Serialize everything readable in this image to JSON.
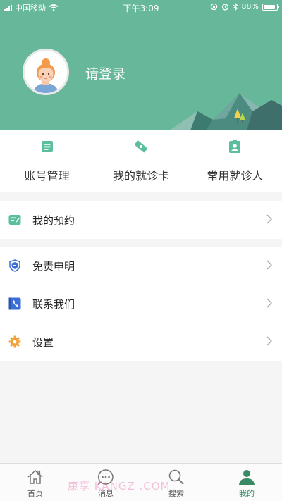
{
  "status_bar": {
    "carrier": "中国移动",
    "time": "下午3:09",
    "battery": "88%",
    "battery_level": 0.88
  },
  "profile": {
    "login_prompt": "请登录"
  },
  "shortcuts": [
    {
      "label": "账号管理",
      "icon": "account-card-icon"
    },
    {
      "label": "我的就诊卡",
      "icon": "visit-card-icon"
    },
    {
      "label": "常用就诊人",
      "icon": "patient-badge-icon"
    }
  ],
  "menu": {
    "appointments": {
      "label": "我的预约",
      "icon": "appointment-icon"
    },
    "disclaimer": {
      "label": "免责申明",
      "icon": "shield-icon"
    },
    "contact": {
      "label": "联系我们",
      "icon": "phone-icon"
    },
    "settings": {
      "label": "设置",
      "icon": "gear-icon"
    }
  },
  "tabbar": {
    "home": "首页",
    "messages": "消息",
    "search": "搜索",
    "mine": "我的",
    "active": "mine"
  },
  "watermark": "康享 KANGZ .COM",
  "colors": {
    "brand_green": "#67b79b",
    "active_tab": "#3a8a66",
    "icon_teal": "#5bbf9c",
    "icon_blue": "#3b6fd6",
    "icon_orange": "#f0a33a"
  }
}
